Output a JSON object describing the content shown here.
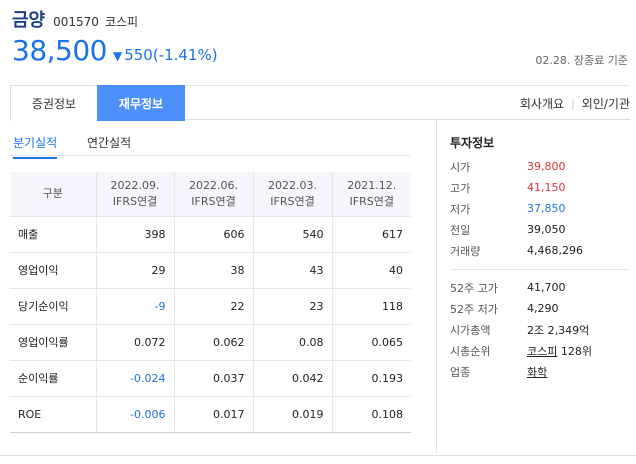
{
  "stock": {
    "name": "금양",
    "code": "001570",
    "market": "코스피",
    "price": "38,500",
    "change_arrow": "▼",
    "change": "550(-1.41%)",
    "date_note": "02.28. 장종료 기준"
  },
  "tabs": {
    "main": [
      "증권정보",
      "재무정보"
    ],
    "active_main": "재무정보",
    "right": [
      "회사개요",
      "외인/기관"
    ]
  },
  "subtabs": {
    "items": [
      "분기실적",
      "연간실적"
    ],
    "active": "분기실적"
  },
  "table": {
    "headers": [
      "구분",
      "2022.09.",
      "2022.06.",
      "2022.03.",
      "2021.12."
    ],
    "header_sub": "IFRS연결",
    "rows": [
      {
        "label": "매출",
        "values": [
          "398",
          "606",
          "540",
          "617"
        ]
      },
      {
        "label": "영업이익",
        "values": [
          "29",
          "38",
          "43",
          "40"
        ]
      },
      {
        "label": "당기순이익",
        "values": [
          "-9",
          "22",
          "23",
          "118"
        ]
      },
      {
        "label": "영업이익률",
        "values": [
          "0.072",
          "0.062",
          "0.08",
          "0.065"
        ]
      },
      {
        "label": "순이익률",
        "values": [
          "-0.024",
          "0.037",
          "0.042",
          "0.193"
        ]
      },
      {
        "label": "ROE",
        "values": [
          "-0.006",
          "0.017",
          "0.019",
          "0.108"
        ]
      }
    ]
  },
  "invest": {
    "title": "투자정보",
    "group1": [
      {
        "k": "시가",
        "v": "39,800"
      },
      {
        "k": "고가",
        "v": "41,150"
      },
      {
        "k": "저가",
        "v": "37,850"
      },
      {
        "k": "전일",
        "v": "39,050"
      },
      {
        "k": "거래량",
        "v": "4,468,296"
      }
    ],
    "group2": [
      {
        "k": "52주 고가",
        "v": "41,700"
      },
      {
        "k": "52주 저가",
        "v": "4,290"
      },
      {
        "k": "시가총액",
        "v": "2조 2,349억"
      },
      {
        "k": "시총순위",
        "v_link": "코스피",
        "v_rest": "128위"
      },
      {
        "k": "업종",
        "v_link": "화학"
      }
    ]
  },
  "colors": {
    "accent_blue": "#1a73e8",
    "tab_active_bg": "#4d8ffb",
    "up_red": "#e0333a",
    "name_navy": "#1d3f8a"
  }
}
